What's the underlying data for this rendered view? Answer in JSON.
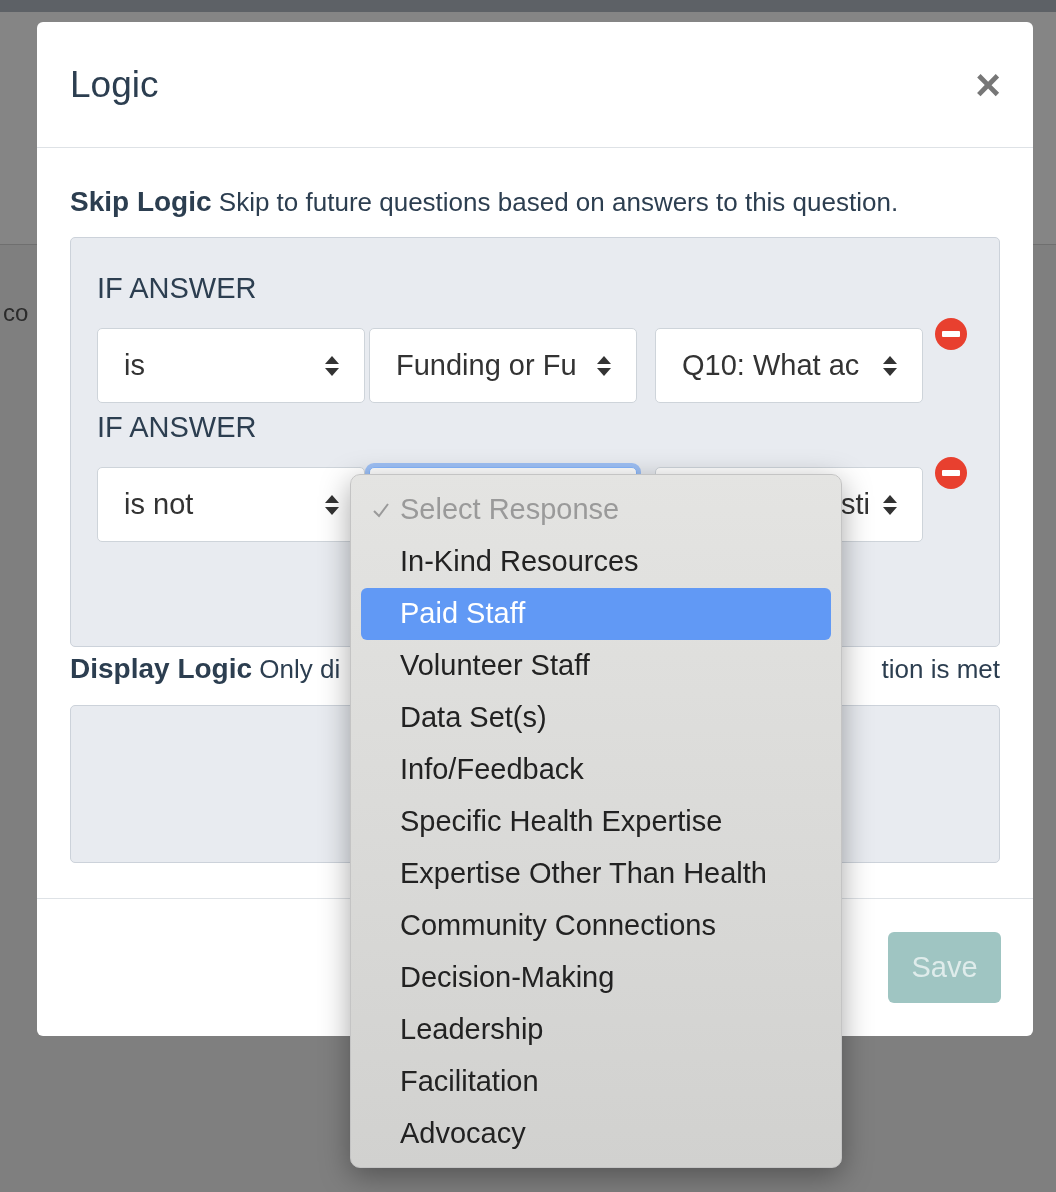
{
  "background_text": "co",
  "modal": {
    "title": "Logic",
    "close": "×"
  },
  "skip_logic": {
    "heading": "Skip Logic",
    "description": "Skip to future questions based on answers to this question.",
    "rules": [
      {
        "label": "IF ANSWER",
        "selects": [
          {
            "kind": "full",
            "value": "is",
            "focused": false
          },
          {
            "kind": "full",
            "value": "Funding or Fu",
            "focused": false
          },
          {
            "kind": "full",
            "value": "Q10: What ac",
            "focused": false
          }
        ]
      },
      {
        "label": "IF ANSWER",
        "selects": [
          {
            "kind": "full",
            "value": "is not",
            "focused": false
          },
          {
            "kind": "covered",
            "focused": true
          },
          {
            "kind": "cut",
            "value": "sti",
            "focused": false
          }
        ]
      }
    ]
  },
  "display_logic": {
    "heading": "Display Logic",
    "description_parts": [
      "Only di",
      "tion is met"
    ]
  },
  "save_button": {
    "label": "Save",
    "disabled": true
  },
  "dropdown": {
    "options": [
      {
        "label": "Select Response",
        "checked": true,
        "disabled": true,
        "selected": false
      },
      {
        "label": "In-Kind Resources",
        "checked": false,
        "disabled": false,
        "selected": false
      },
      {
        "label": "Paid Staff",
        "checked": false,
        "disabled": false,
        "selected": true
      },
      {
        "label": "Volunteer Staff",
        "checked": false,
        "disabled": false,
        "selected": false
      },
      {
        "label": "Data Set(s)",
        "checked": false,
        "disabled": false,
        "selected": false
      },
      {
        "label": "Info/Feedback",
        "checked": false,
        "disabled": false,
        "selected": false
      },
      {
        "label": "Specific Health Expertise",
        "checked": false,
        "disabled": false,
        "selected": false
      },
      {
        "label": "Expertise Other Than Health",
        "checked": false,
        "disabled": false,
        "selected": false
      },
      {
        "label": "Community Connections",
        "checked": false,
        "disabled": false,
        "selected": false
      },
      {
        "label": "Decision-Making",
        "checked": false,
        "disabled": false,
        "selected": false
      },
      {
        "label": "Leadership",
        "checked": false,
        "disabled": false,
        "selected": false
      },
      {
        "label": "Facilitation",
        "checked": false,
        "disabled": false,
        "selected": false
      },
      {
        "label": "Advocacy",
        "checked": false,
        "disabled": false,
        "selected": false
      }
    ]
  }
}
